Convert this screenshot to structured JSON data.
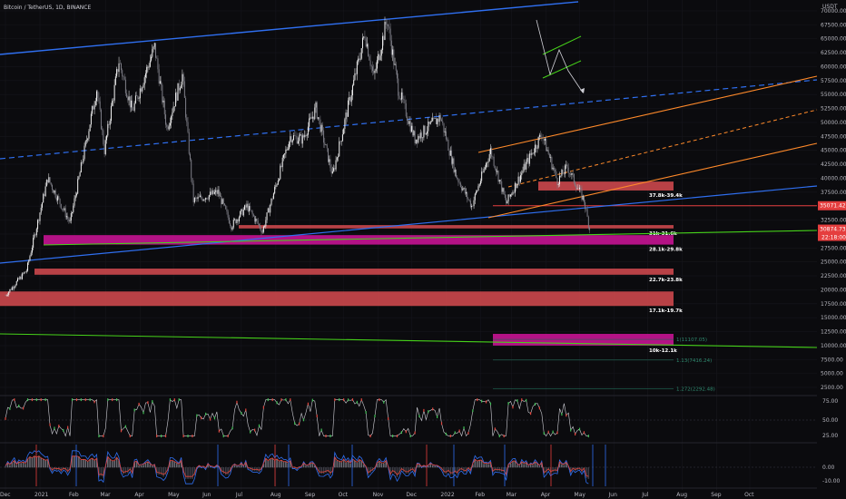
{
  "chart_data": {
    "type": "candlestick",
    "title": "Bitcoin / TetherUS, 1D, BINANCE",
    "currency_label": "USDT",
    "y_ticks": [
      "70000.00",
      "67500.00",
      "65000.00",
      "62500.00",
      "60000.00",
      "57500.00",
      "55000.00",
      "52500.00",
      "50000.00",
      "47500.00",
      "45000.00",
      "42500.00",
      "40000.00",
      "37500.00",
      "35000.00",
      "32500.00",
      "30000.00",
      "27500.00",
      "25000.00",
      "22500.00",
      "20000.00",
      "17500.00",
      "15000.00",
      "12500.00",
      "10000.00",
      "7500.00",
      "5000.00",
      "2500.00"
    ],
    "ylim": [
      2500,
      70000
    ],
    "x_ticks": [
      "Dec",
      "2021",
      "Feb",
      "Mar",
      "Apr",
      "May",
      "Jun",
      "Jul",
      "Aug",
      "Sep",
      "Oct",
      "Nov",
      "Dec",
      "2022",
      "Feb",
      "Mar",
      "Apr",
      "May",
      "Jun",
      "Jul",
      "Aug",
      "Sep",
      "Oct"
    ],
    "price_path": [
      [
        "2020-12-01",
        19000
      ],
      [
        "2020-12-20",
        23500
      ],
      [
        "2021-01-08",
        40000
      ],
      [
        "2021-01-28",
        32000
      ],
      [
        "2021-02-21",
        56000
      ],
      [
        "2021-02-28",
        45000
      ],
      [
        "2021-03-13",
        61000
      ],
      [
        "2021-03-25",
        52000
      ],
      [
        "2021-04-14",
        63500
      ],
      [
        "2021-04-25",
        49000
      ],
      [
        "2021-05-09",
        58500
      ],
      [
        "2021-05-19",
        36000
      ],
      [
        "2021-06-10",
        37500
      ],
      [
        "2021-06-22",
        31500
      ],
      [
        "2021-07-06",
        35000
      ],
      [
        "2021-07-20",
        30500
      ],
      [
        "2021-08-14",
        47500
      ],
      [
        "2021-08-25",
        47000
      ],
      [
        "2021-09-06",
        52500
      ],
      [
        "2021-09-21",
        40500
      ],
      [
        "2021-10-20",
        66000
      ],
      [
        "2021-10-28",
        58000
      ],
      [
        "2021-11-09",
        68500
      ],
      [
        "2021-11-19",
        56000
      ],
      [
        "2021-12-04",
        47000
      ],
      [
        "2021-12-27",
        51000
      ],
      [
        "2022-01-10",
        40500
      ],
      [
        "2022-01-24",
        35000
      ],
      [
        "2022-02-10",
        45000
      ],
      [
        "2022-02-24",
        35500
      ],
      [
        "2022-03-28",
        48000
      ],
      [
        "2022-04-11",
        39500
      ],
      [
        "2022-04-20",
        42000
      ],
      [
        "2022-05-05",
        36000
      ],
      [
        "2022-05-10",
        30874.73
      ]
    ],
    "current_price_label": "30874.73",
    "countdown_label": "22:18:00",
    "price_tags": [
      {
        "value": "35071.42",
        "color": "#e53e3e"
      },
      {
        "value": "30874.73",
        "color": "#e53e3e"
      }
    ],
    "zones": [
      {
        "label": "37.8k-39.4k",
        "from": 37800,
        "to": 39400,
        "color": "#c8474b"
      },
      {
        "label": "31k-31.6k",
        "from": 31000,
        "to": 31600,
        "color": "#c8474b"
      },
      {
        "label": "28.1k-29.8k",
        "from": 28100,
        "to": 29800,
        "color": "#c2138f"
      },
      {
        "label": "22.7k-23.8k",
        "from": 22700,
        "to": 23800,
        "color": "#c8474b"
      },
      {
        "label": "17.1k-19.7k",
        "from": 17100,
        "to": 19700,
        "color": "#c8474b"
      },
      {
        "label": "10k-12.1k",
        "from": 10000,
        "to": 12100,
        "color": "#c2138f"
      }
    ],
    "fib_levels": [
      {
        "label": "1(11107.05)",
        "value": 11107.05
      },
      {
        "label": "1.13(7416.24)",
        "value": 7416.24
      },
      {
        "label": "1.272(2292.48)",
        "value": 2292.48
      }
    ],
    "oscillator_1_ticks": [
      "75.00",
      "50.00",
      "25.00"
    ],
    "oscillator_2_ticks": [
      "0.00",
      "-10.00"
    ]
  }
}
